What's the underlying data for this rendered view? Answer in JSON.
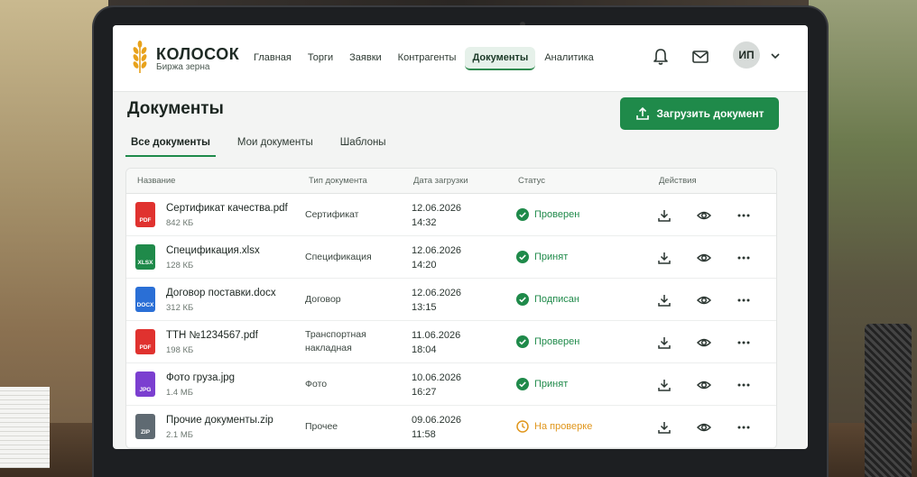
{
  "brand": {
    "name": "КОЛОСОК",
    "subtitle": "Биржа зерна"
  },
  "nav": [
    {
      "label": "Главная",
      "active": false
    },
    {
      "label": "Торги",
      "active": false
    },
    {
      "label": "Заявки",
      "active": false
    },
    {
      "label": "Контрагенты",
      "active": false
    },
    {
      "label": "Документы",
      "active": true
    },
    {
      "label": "Аналитика",
      "active": false
    }
  ],
  "user": {
    "initials": "ИП"
  },
  "page": {
    "title": "Документы",
    "upload_label": "Загрузить документ"
  },
  "tabs": [
    {
      "label": "Все документы",
      "active": true
    },
    {
      "label": "Мои документы",
      "active": false
    },
    {
      "label": "Шаблоны",
      "active": false
    }
  ],
  "table": {
    "headers": {
      "name": "Название",
      "type": "Тип документа",
      "date": "Дата загрузки",
      "status": "Статус",
      "actions": "Действия"
    },
    "rows": [
      {
        "icon": "pdf",
        "icon_label": "PDF",
        "icon_color": "#e0322f",
        "name": "Сертификат качества.pdf",
        "size": "842 КБ",
        "type": "Сертификат",
        "date": "12.06.2026",
        "time": "14:32",
        "status": "Проверен",
        "status_kind": "ok"
      },
      {
        "icon": "xlsx",
        "icon_label": "XLSX",
        "icon_color": "#1f8a4a",
        "name": "Спецификация.xlsx",
        "size": "128 КБ",
        "type": "Спецификация",
        "date": "12.06.2026",
        "time": "14:20",
        "status": "Принят",
        "status_kind": "ok"
      },
      {
        "icon": "docx",
        "icon_label": "DOCX",
        "icon_color": "#2a6fd6",
        "name": "Договор поставки.docx",
        "size": "312 КБ",
        "type": "Договор",
        "date": "12.06.2026",
        "time": "13:15",
        "status": "Подписан",
        "status_kind": "ok"
      },
      {
        "icon": "pdf",
        "icon_label": "PDF",
        "icon_color": "#e0322f",
        "name": "ТТН №1234567.pdf",
        "size": "198 КБ",
        "type": "Транспортная",
        "type2": "накладная",
        "date": "11.06.2026",
        "time": "18:04",
        "status": "Проверен",
        "status_kind": "ok"
      },
      {
        "icon": "jpg",
        "icon_label": "JPG",
        "icon_color": "#7b3fd0",
        "name": "Фото груза.jpg",
        "size": "1.4 МБ",
        "type": "Фото",
        "date": "10.06.2026",
        "time": "16:27",
        "status": "Принят",
        "status_kind": "ok"
      },
      {
        "icon": "zip",
        "icon_label": "ZIP",
        "icon_color": "#5f6a72",
        "name": "Прочие документы.zip",
        "size": "2.1 МБ",
        "type": "Прочее",
        "date": "09.06.2026",
        "time": "11:58",
        "status": "На проверке",
        "status_kind": "pending"
      }
    ]
  },
  "colors": {
    "accent": "#1f8a4a",
    "pending": "#e0961c"
  }
}
